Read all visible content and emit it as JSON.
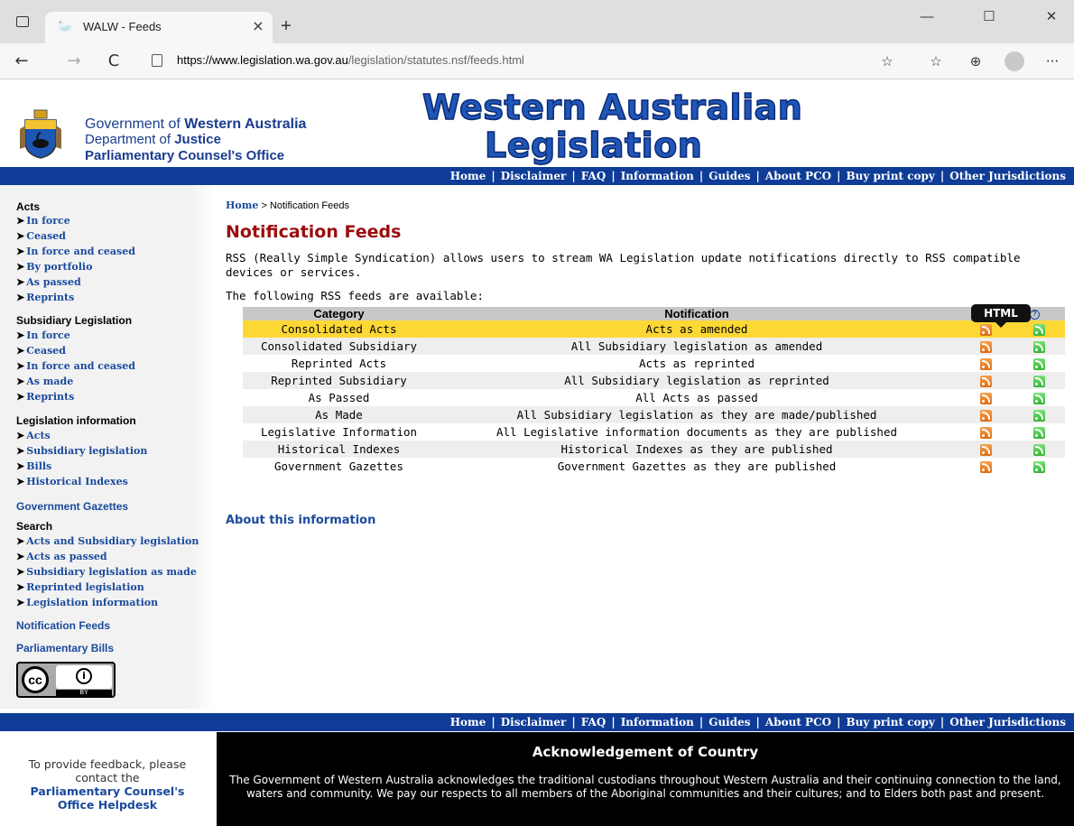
{
  "browser": {
    "tab_title": "WALW - Feeds",
    "tab_close": "×",
    "new_tab": "+",
    "minimize": "—",
    "maximize": "☐",
    "close": "✕",
    "back": "←",
    "forward": "→",
    "reload": "C",
    "url_domain": "https://www.legislation.wa.gov.au",
    "url_path": "/legislation/statutes.nsf/feeds.html",
    "more": "···"
  },
  "header": {
    "gov_line1_prefix": "Government of ",
    "gov_line1_bold": "Western Australia",
    "gov_line2_prefix": "Department of ",
    "gov_line2_bold": "Justice",
    "gov_line3": "Parliamentary Counsel's Office",
    "title_line1": "Western Australian",
    "title_line2": "Legislation"
  },
  "topnav": [
    "Home",
    "Disclaimer",
    "FAQ",
    "Information",
    "Guides",
    "About PCO",
    "Buy print copy",
    "Other Jurisdictions"
  ],
  "sidebar": {
    "acts": {
      "heading": "Acts",
      "items": [
        "In force",
        "Ceased",
        "In force and ceased",
        "By portfolio",
        "As passed",
        "Reprints"
      ]
    },
    "subsidiary": {
      "heading": "Subsidiary Legislation",
      "items": [
        "In force",
        "Ceased",
        "In force and ceased",
        "As made",
        "Reprints"
      ]
    },
    "info": {
      "heading": "Legislation information",
      "items": [
        "Acts",
        "Subsidiary legislation",
        "Bills",
        "Historical Indexes"
      ]
    },
    "gazettes": "Government Gazettes",
    "search": {
      "heading": "Search",
      "items": [
        "Acts and Subsidiary legislation",
        "Acts as passed",
        "Subsidiary legislation as made",
        "Reprinted legislation",
        "Legislation information"
      ]
    },
    "notification_feeds": "Notification Feeds",
    "parliamentary_bills": "Parliamentary Bills",
    "cc_label": "cc",
    "cc_by": "BY"
  },
  "main": {
    "breadcrumb_home": "Home",
    "breadcrumb_sep": ">",
    "breadcrumb_current": "Notification Feeds",
    "title": "Notification Feeds",
    "intro": "RSS (Really Simple Syndication) allows users to stream WA Legislation update notifications directly to RSS compatible devices or services.",
    "available": "The following RSS feeds are available:",
    "tooltip": "HTML",
    "headers": {
      "category": "Category",
      "notification": "Notification",
      "feed": "ed"
    },
    "about": "About this information"
  },
  "feeds": [
    {
      "category": "Consolidated Acts",
      "notification": "Acts as amended"
    },
    {
      "category": "Consolidated Subsidiary",
      "notification": "All Subsidiary legislation as amended"
    },
    {
      "category": "Reprinted Acts",
      "notification": "Acts as reprinted"
    },
    {
      "category": "Reprinted Subsidiary",
      "notification": "All Subsidiary legislation as reprinted"
    },
    {
      "category": "As Passed",
      "notification": "All Acts as passed"
    },
    {
      "category": "As Made",
      "notification": "All Subsidiary legislation as they are made/published"
    },
    {
      "category": "Legislative Information",
      "notification": "All Legislative information documents as they are published"
    },
    {
      "category": "Historical Indexes",
      "notification": "Historical Indexes as they are published"
    },
    {
      "category": "Government Gazettes",
      "notification": "Government Gazettes as they are published"
    }
  ],
  "footer": {
    "feedback_line1": "To provide feedback, please",
    "feedback_line2": "contact the",
    "feedback_link1": "Parliamentary Counsel's",
    "feedback_link2": "Office Helpdesk",
    "ack_title": "Acknowledgement of Country",
    "ack_text": "The Government of Western Australia acknowledges the traditional custodians throughout Western Australia and their continuing connection to the land, waters and community. We pay our respects to all members of the Aboriginal communities and their cultures; and to Elders both past and present."
  },
  "colors": {
    "nav_blue": "#0e3c96",
    "title_red": "#9b0d0d",
    "highlight": "#fdd835",
    "link": "#1a4a9c"
  }
}
